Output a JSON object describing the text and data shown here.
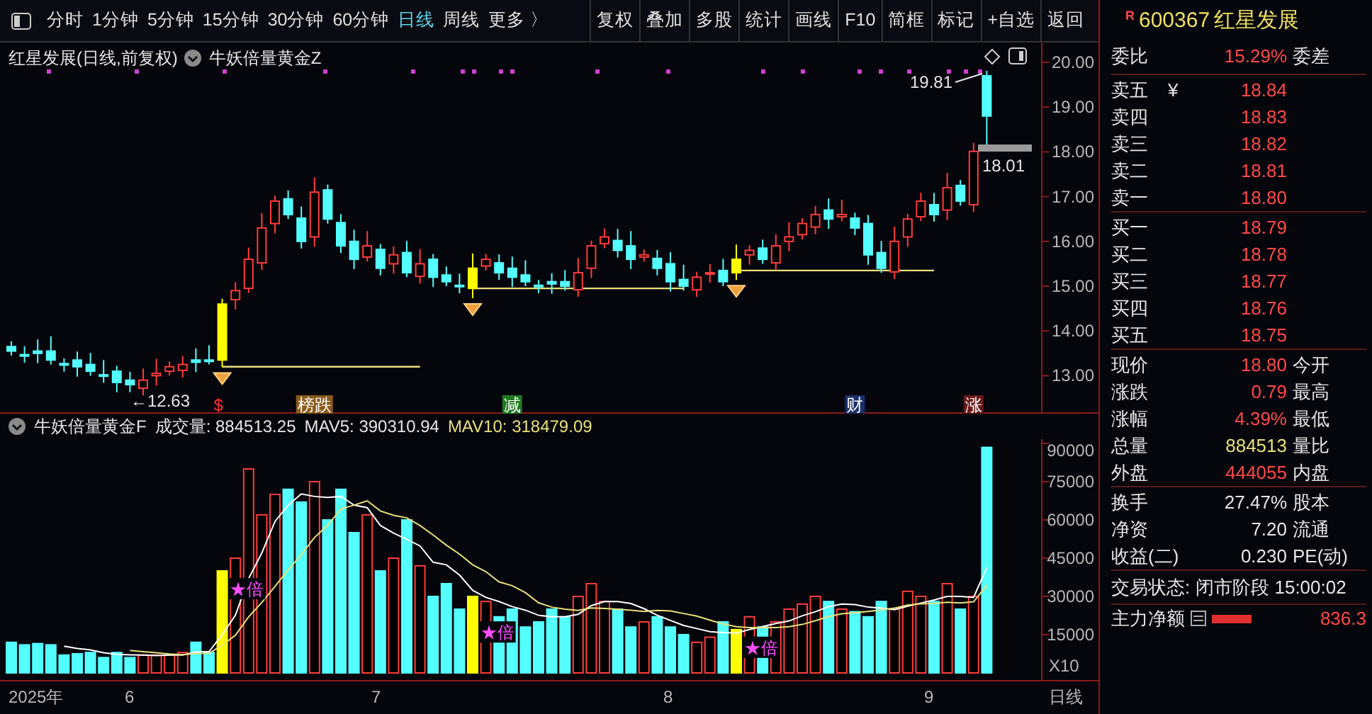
{
  "toolbar": {
    "periods": [
      {
        "label": "分时",
        "selected": false
      },
      {
        "label": "1分钟",
        "selected": false
      },
      {
        "label": "5分钟",
        "selected": false
      },
      {
        "label": "15分钟",
        "selected": false
      },
      {
        "label": "30分钟",
        "selected": false
      },
      {
        "label": "60分钟",
        "selected": false
      },
      {
        "label": "日线",
        "selected": true
      },
      {
        "label": "周线",
        "selected": false
      },
      {
        "label": "更多 〉",
        "selected": false
      }
    ],
    "buttons": [
      "复权",
      "叠加",
      "多股",
      "统计",
      "画线",
      "F10",
      "简框",
      "标记",
      "+自选",
      "返回"
    ]
  },
  "price_chart": {
    "title": "红星发展(日线,前复权)",
    "indicator": "牛妖倍量黄金Z",
    "y_ticks": [
      "20.00",
      "19.00",
      "18.00",
      "17.00",
      "16.00",
      "15.00",
      "14.00",
      "13.00"
    ],
    "high_label": "19.81",
    "last_label": "18.01",
    "low_label": "←12.63",
    "markers": [
      {
        "text": "$",
        "kind": "sell"
      },
      {
        "text": "榜跌",
        "kind": "rank"
      },
      {
        "text": "减",
        "kind": "cut"
      },
      {
        "text": "财",
        "kind": "finance"
      },
      {
        "text": "涨",
        "kind": "rise"
      }
    ]
  },
  "volume_chart": {
    "indicator": "牛妖倍量黄金F",
    "volume": "成交量: 884513.25",
    "mav5": "MAV5: 390310.94",
    "mav10": "MAV10: 318479.09",
    "y_ticks": [
      "90000",
      "75000",
      "60000",
      "45000",
      "30000",
      "15000"
    ],
    "multiplier": "X10",
    "signals": [
      "★倍",
      "★倍",
      "★倍"
    ]
  },
  "date_axis": {
    "labels": [
      "2025年",
      "6",
      "7",
      "8",
      "9"
    ],
    "period": "日线"
  },
  "quote": {
    "badge": "R",
    "code": "600367",
    "name": "红星发展"
  },
  "order_ratio": {
    "label": "委比",
    "value": "15.29%",
    "label2": "委差"
  },
  "asks": [
    {
      "label": "卖五",
      "mark": "¥",
      "price": "18.84"
    },
    {
      "label": "卖四",
      "price": "18.83"
    },
    {
      "label": "卖三",
      "price": "18.82"
    },
    {
      "label": "卖二",
      "price": "18.81"
    },
    {
      "label": "卖一",
      "price": "18.80"
    }
  ],
  "bids": [
    {
      "label": "买一",
      "price": "18.79"
    },
    {
      "label": "买二",
      "price": "18.78"
    },
    {
      "label": "买三",
      "price": "18.77"
    },
    {
      "label": "买四",
      "price": "18.76"
    },
    {
      "label": "买五",
      "price": "18.75"
    }
  ],
  "stats": [
    {
      "label": "现价",
      "value": "18.80",
      "label2": "今开",
      "kind": "up"
    },
    {
      "label": "涨跌",
      "value": "0.79",
      "label2": "最高",
      "kind": "up"
    },
    {
      "label": "涨幅",
      "value": "4.39%",
      "label2": "最低",
      "kind": "up"
    },
    {
      "label": "总量",
      "value": "884513",
      "label2": "量比",
      "kind": "volume"
    },
    {
      "label": "外盘",
      "value": "444055",
      "label2": "内盘",
      "kind": "up"
    }
  ],
  "stats2": [
    {
      "label": "换手",
      "value": "27.47%",
      "label2": "股本",
      "kind": "plain"
    },
    {
      "label": "净资",
      "value": "7.20",
      "label2": "流通",
      "kind": "plain"
    },
    {
      "label": "收益(二)",
      "value": "0.230",
      "label2": "PE(动)",
      "kind": "plain"
    }
  ],
  "trade_status": {
    "label": "交易状态:",
    "value": "闭市阶段 15:00:02"
  },
  "main_flow": {
    "label": "主力净额",
    "value": "836.3"
  }
}
